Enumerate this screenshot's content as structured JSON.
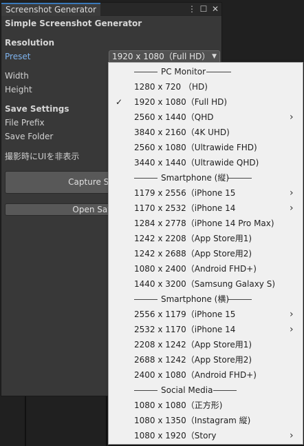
{
  "window": {
    "tab_title": "Screenshot Generator",
    "menu_icon": "⋮",
    "maximize_icon": "☐",
    "close_icon": "✕"
  },
  "panel": {
    "title": "Simple Screenshot Generator",
    "resolution_header": "Resolution",
    "preset_label": "Preset",
    "preset_value": "1920 x 1080（Full HD）",
    "width_label": "Width",
    "height_label": "Height",
    "save_settings_header": "Save Settings",
    "file_prefix_label": "File Prefix",
    "save_folder_label": "Save Folder",
    "hide_ui_label": "撮影時にUIを非表示",
    "capture_button": "Capture Screenshot",
    "open_button": "Open Save Folder"
  },
  "menu": {
    "items": [
      {
        "type": "separator",
        "label": "PC Monitor"
      },
      {
        "type": "item",
        "label": "1280 x 720 （HD)",
        "checked": false,
        "submenu": false
      },
      {
        "type": "item",
        "label": "1920 x 1080（Full HD)",
        "checked": true,
        "submenu": false
      },
      {
        "type": "item",
        "label": "2560 x 1440（QHD",
        "checked": false,
        "submenu": true
      },
      {
        "type": "item",
        "label": "3840 x 2160（4K UHD)",
        "checked": false,
        "submenu": false
      },
      {
        "type": "item",
        "label": "2560 x 1080（Ultrawide FHD)",
        "checked": false,
        "submenu": false
      },
      {
        "type": "item",
        "label": "3440 x 1440（Ultrawide QHD)",
        "checked": false,
        "submenu": false
      },
      {
        "type": "separator",
        "label": "Smartphone (縦)"
      },
      {
        "type": "item",
        "label": "1179 x 2556（iPhone 15",
        "checked": false,
        "submenu": true
      },
      {
        "type": "item",
        "label": "1170 x 2532（iPhone 14",
        "checked": false,
        "submenu": true
      },
      {
        "type": "item",
        "label": "1284 x 2778（iPhone 14 Pro Max)",
        "checked": false,
        "submenu": false
      },
      {
        "type": "item",
        "label": "1242 x 2208（App Store用1)",
        "checked": false,
        "submenu": false
      },
      {
        "type": "item",
        "label": "1242 x 2688（App Store用2)",
        "checked": false,
        "submenu": false
      },
      {
        "type": "item",
        "label": "1080 x 2400（Android FHD+)",
        "checked": false,
        "submenu": false
      },
      {
        "type": "item",
        "label": "1440 x 3200（Samsung Galaxy S)",
        "checked": false,
        "submenu": false
      },
      {
        "type": "separator",
        "label": "Smartphone (横)"
      },
      {
        "type": "item",
        "label": "2556 x 1179（iPhone 15",
        "checked": false,
        "submenu": true
      },
      {
        "type": "item",
        "label": "2532 x 1170（iPhone 14",
        "checked": false,
        "submenu": true
      },
      {
        "type": "item",
        "label": "2208 x 1242（App Store用1)",
        "checked": false,
        "submenu": false
      },
      {
        "type": "item",
        "label": "2688 x 1242（App Store用2)",
        "checked": false,
        "submenu": false
      },
      {
        "type": "item",
        "label": "2400 x 1080（Android FHD+)",
        "checked": false,
        "submenu": false
      },
      {
        "type": "separator",
        "label": "Social Media"
      },
      {
        "type": "item",
        "label": "1080 x 1080（正方形)",
        "checked": false,
        "submenu": false
      },
      {
        "type": "item",
        "label": "1080 x 1350（Instagram 縦)",
        "checked": false,
        "submenu": false
      },
      {
        "type": "item",
        "label": "1080 x 1920（Story",
        "checked": false,
        "submenu": true
      }
    ]
  },
  "colors": {
    "accent_blue": "#7fb4ef",
    "tab_highlight": "#3a79bb",
    "panel_bg": "#383838",
    "menu_bg": "#f0f0f0"
  }
}
